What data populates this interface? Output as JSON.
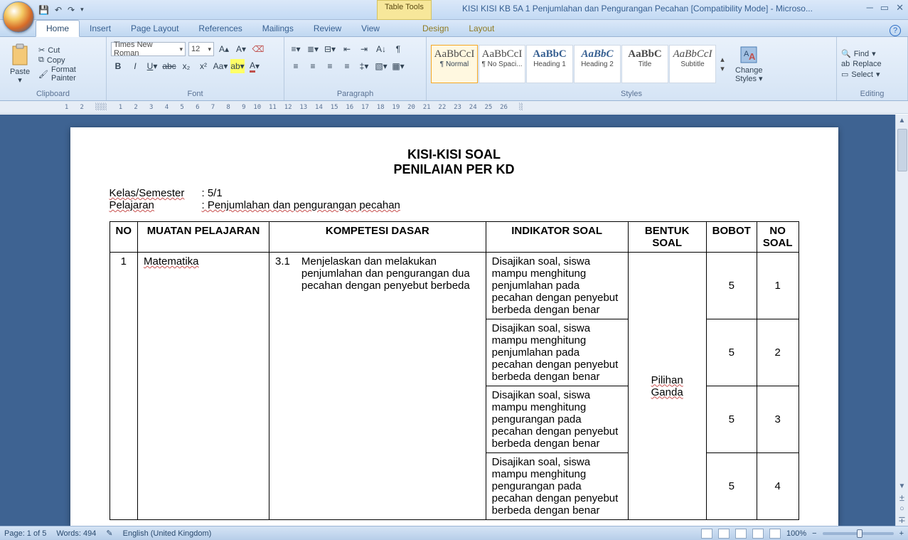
{
  "window": {
    "table_tools": "Table Tools",
    "title": "KISI KISI KB  5A 1 Penjumlahan dan Pengurangan Pecahan [Compatibility Mode] - Microso..."
  },
  "tabs": [
    "Home",
    "Insert",
    "Page Layout",
    "References",
    "Mailings",
    "Review",
    "View",
    "Design",
    "Layout"
  ],
  "ribbon": {
    "clipboard": {
      "paste": "Paste",
      "cut": "Cut",
      "copy": "Copy",
      "fp": "Format Painter",
      "label": "Clipboard"
    },
    "font": {
      "name": "Times New Roman",
      "size": "12",
      "label": "Font"
    },
    "paragraph": {
      "label": "Paragraph"
    },
    "styles": {
      "label": "Styles",
      "change": "Change\nStyles",
      "items": [
        {
          "prev": "AaBbCcI",
          "name": "¶ Normal"
        },
        {
          "prev": "AaBbCcI",
          "name": "¶ No Spaci..."
        },
        {
          "prev": "AaBbC",
          "name": "Heading 1"
        },
        {
          "prev": "AaBbC",
          "name": "Heading 2"
        },
        {
          "prev": "AaBbC",
          "name": "Title"
        },
        {
          "prev": "AaBbCcI",
          "name": "Subtitle"
        }
      ]
    },
    "editing": {
      "find": "Find",
      "replace": "Replace",
      "select": "Select",
      "label": "Editing"
    }
  },
  "doc": {
    "title1": "KISI-KISI SOAL",
    "title2": "PENILAIAN PER KD",
    "meta": {
      "k1": "Kelas/Semester",
      "v1": ": 5/1",
      "k2": "Pelajaran",
      "v2": ": Penjumlahan dan pengurangan pecahan"
    },
    "head": [
      "NO",
      "MUATAN PELAJARAN",
      "KOMPETESI DASAR",
      "INDIKATOR SOAL",
      "BENTUK SOAL",
      "BOBOT",
      "NO SOAL"
    ],
    "no": "1",
    "subject": "Matematika",
    "kd_no": "3.1",
    "kd_text": "Menjelaskan dan melakukan penjumlahan dan pengurangan dua pecahan dengan penyebut berbeda",
    "rows": [
      {
        "ind": "Disajikan soal, siswa mampu menghitung penjumlahan pada pecahan dengan penyebut berbeda dengan benar",
        "bobot": "5",
        "ns": "1"
      },
      {
        "ind": "Disajikan soal, siswa mampu menghitung penjumlahan pada pecahan dengan penyebut berbeda dengan benar",
        "bobot": "5",
        "ns": "2"
      },
      {
        "ind": "Disajikan soal, siswa mampu menghitung pengurangan pada pecahan dengan penyebut berbeda dengan benar",
        "bobot": "5",
        "ns": "3"
      },
      {
        "ind": "Disajikan soal, siswa mampu menghitung pengurangan pada pecahan dengan penyebut berbeda dengan benar",
        "bobot": "5",
        "ns": "4"
      }
    ],
    "bentuk": "Pilihan Ganda"
  },
  "status": {
    "page": "Page: 1 of 5",
    "words": "Words: 494",
    "lang": "English (United Kingdom)",
    "zoom": "100%"
  }
}
